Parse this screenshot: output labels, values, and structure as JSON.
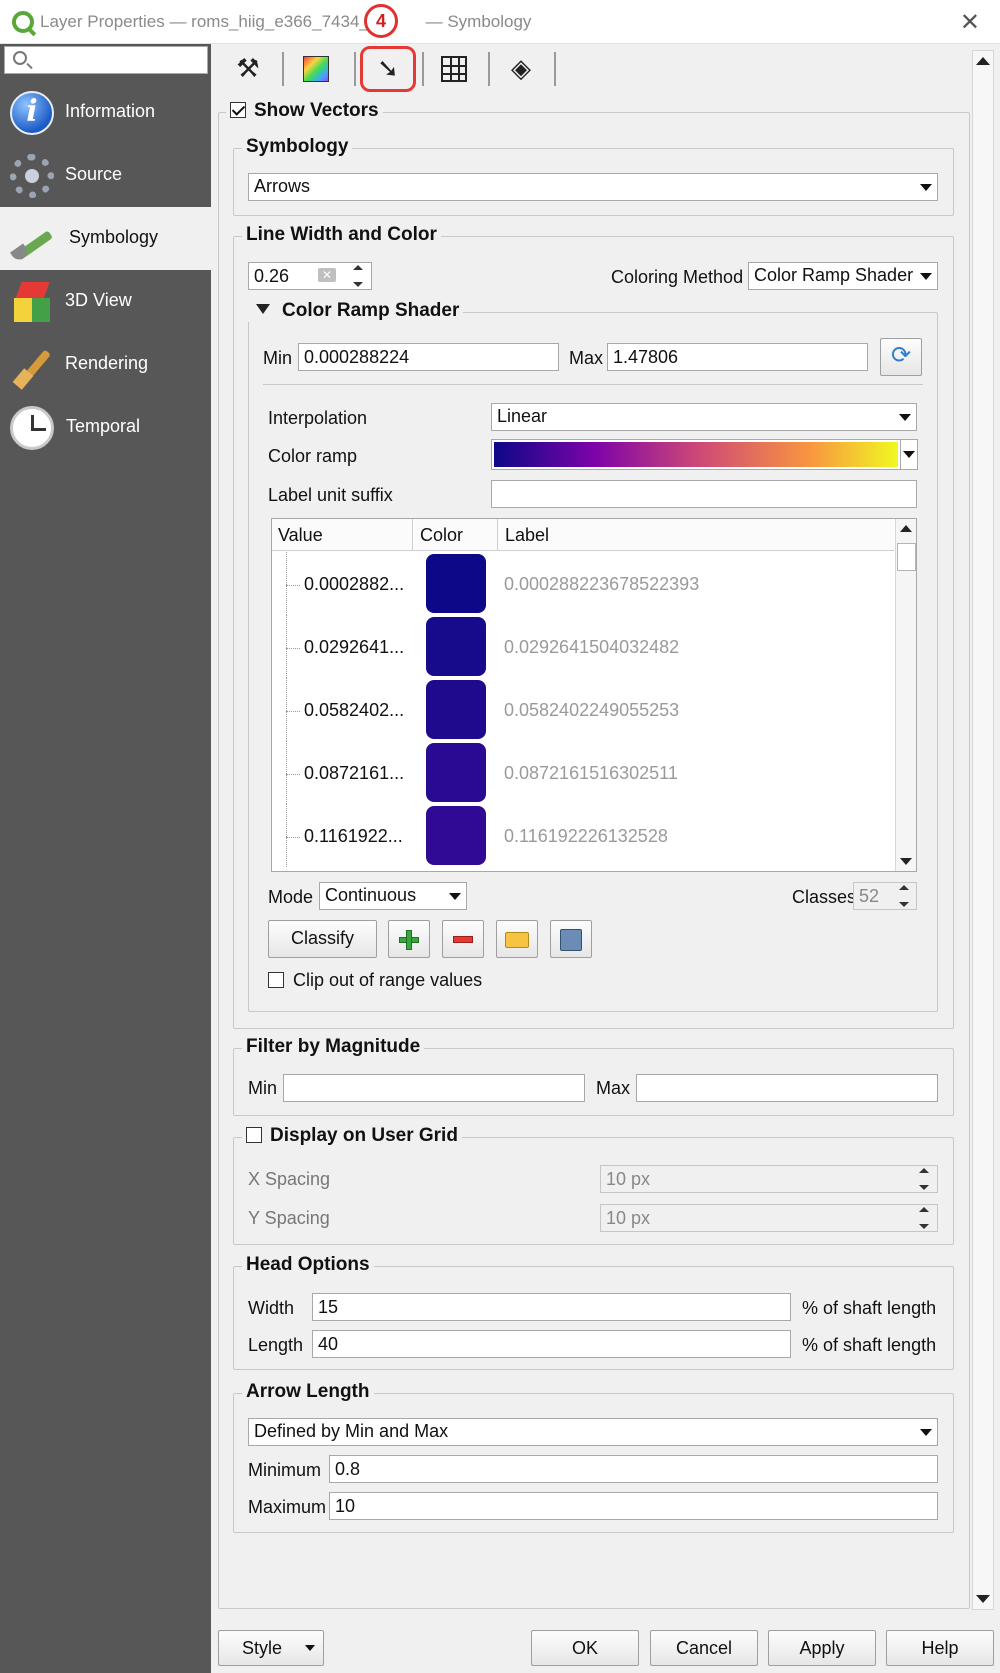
{
  "window": {
    "title_prefix": "Layer Properties — roms_hiig_e366_7434_f",
    "title_suffix": "— Symbology",
    "callout": "4"
  },
  "sidebar": {
    "items": [
      {
        "label": "Information",
        "icon": "info-icon"
      },
      {
        "label": "Source",
        "icon": "gear-icon"
      },
      {
        "label": "Symbology",
        "icon": "paintbrush-icon"
      },
      {
        "label": "3D View",
        "icon": "cube-icon"
      },
      {
        "label": "Rendering",
        "icon": "rendering-brush-icon"
      },
      {
        "label": "Temporal",
        "icon": "clock-icon"
      }
    ],
    "active": "Symbology"
  },
  "tabs": [
    {
      "icon": "tools-icon"
    },
    {
      "icon": "color-ramp-icon"
    },
    {
      "icon": "vector-arrow-icon",
      "active": true
    },
    {
      "icon": "grid-icon"
    },
    {
      "icon": "layers-icon"
    }
  ],
  "show_vectors": {
    "label": "Show Vectors",
    "checked": true
  },
  "symbology": {
    "group_label": "Symbology",
    "value": "Arrows"
  },
  "line_width_color": {
    "group_label": "Line Width and Color",
    "width_value": "0.26",
    "coloring_method_label": "Coloring Method",
    "coloring_method_value": "Color Ramp Shader"
  },
  "color_ramp_shader": {
    "group_label": "Color Ramp Shader",
    "min_label": "Min",
    "min_value": "0.000288224",
    "max_label": "Max",
    "max_value": "1.47806",
    "interpolation_label": "Interpolation",
    "interpolation_value": "Linear",
    "color_ramp_label": "Color ramp",
    "label_unit_suffix_label": "Label unit suffix",
    "label_unit_suffix_value": "",
    "table": {
      "columns": [
        "Value",
        "Color",
        "Label"
      ],
      "rows": [
        {
          "value": "0.0002882...",
          "color": "#0d0887",
          "label": "0.000288223678522393"
        },
        {
          "value": "0.0292641...",
          "color": "#170a8b",
          "label": "0.0292641504032482"
        },
        {
          "value": "0.0582402...",
          "color": "#1f0a8e",
          "label": "0.0582402249055253"
        },
        {
          "value": "0.0872161...",
          "color": "#280b92",
          "label": "0.0872161516302511"
        },
        {
          "value": "0.1161922...",
          "color": "#300a95",
          "label": "0.116192226132528"
        }
      ]
    },
    "mode_label": "Mode",
    "mode_value": "Continuous",
    "classes_label": "Classes",
    "classes_value": "52",
    "classify_label": "Classify",
    "clip_label": "Clip out of range values",
    "clip_checked": false
  },
  "filter_by_magnitude": {
    "group_label": "Filter by Magnitude",
    "min_label": "Min",
    "min_value": "",
    "max_label": "Max",
    "max_value": ""
  },
  "user_grid": {
    "group_label": "Display on User Grid",
    "checked": false,
    "x_label": "X Spacing",
    "x_value": "10 px",
    "y_label": "Y Spacing",
    "y_value": "10 px"
  },
  "head_options": {
    "group_label": "Head Options",
    "width_label": "Width",
    "width_value": "15",
    "length_label": "Length",
    "length_value": "40",
    "unit": "% of shaft length"
  },
  "arrow_length": {
    "group_label": "Arrow Length",
    "mode_value": "Defined by Min and Max",
    "minimum_label": "Minimum",
    "minimum_value": "0.8",
    "maximum_label": "Maximum",
    "maximum_value": "10"
  },
  "footer": {
    "style": "Style",
    "ok": "OK",
    "cancel": "Cancel",
    "apply": "Apply",
    "help": "Help"
  },
  "colors": {
    "sidebar_bg": "#575757",
    "highlight": "#e53935",
    "ramp_start": "#0d0887",
    "ramp_mid": "#cc4778",
    "ramp_end": "#f0f921"
  }
}
